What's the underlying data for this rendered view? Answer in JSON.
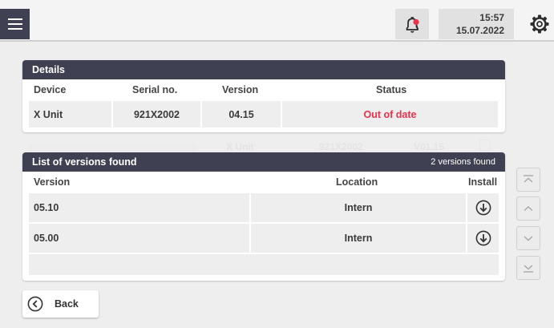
{
  "header": {
    "time": "15:57",
    "date": "15.07.2022",
    "icons": [
      "menu-icon",
      "bell-icon",
      "settings-gear-icon"
    ],
    "notification_color": "#e8334a"
  },
  "details": {
    "title": "Details",
    "columns": [
      "Device",
      "Serial no.",
      "Version",
      "Status"
    ],
    "row": {
      "device": "X Unit",
      "serial": "921X2002",
      "version": "04.15",
      "status": "Out of date"
    },
    "status_color": "#e8334a"
  },
  "background_row": {
    "device": "X Unit",
    "serial": "921X2002",
    "version": "V01.15"
  },
  "versions": {
    "title": "List of versions found",
    "count_text": "2 versions found",
    "columns": [
      "Version",
      "Location",
      "Install"
    ],
    "rows": [
      {
        "version": "05.10",
        "location": "Intern"
      },
      {
        "version": "05.00",
        "location": "Intern"
      }
    ]
  },
  "scroll_controls": [
    "scroll-top-icon",
    "scroll-up-icon",
    "scroll-down-icon",
    "scroll-bottom-icon"
  ],
  "back_label": "Back"
}
